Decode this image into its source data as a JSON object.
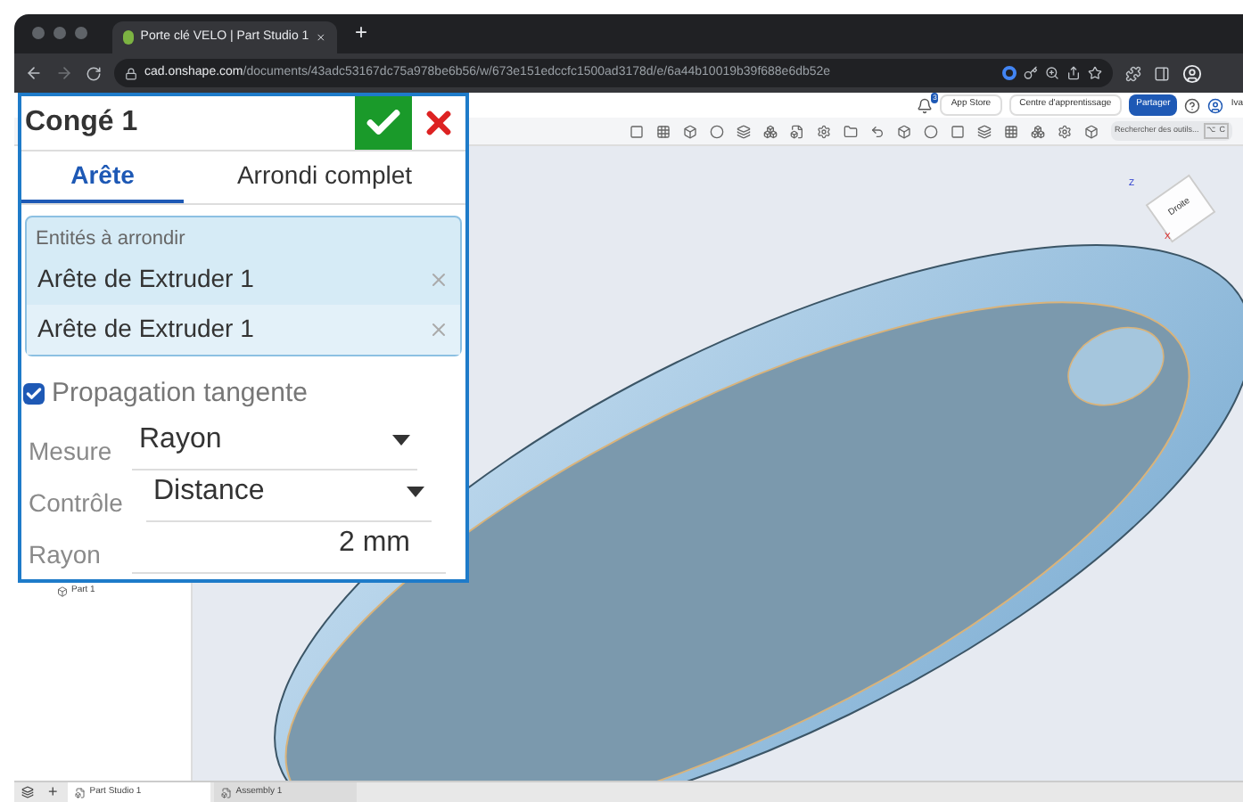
{
  "browser": {
    "tab_title": "Porte clé VELO | Part Studio 1",
    "new_tab": "+",
    "url_host": "cad.onshape.com",
    "url_path": "/documents/43adc53167dc75a978be6b56/w/673e151edccfc1500ad3178d/e/6a44b10019b39f688e6db52e"
  },
  "app_header": {
    "notification_count": "3",
    "buttons": [
      {
        "label": "App Store",
        "kind": "plain"
      },
      {
        "label": "Centre d'apprentissage",
        "kind": "plain"
      },
      {
        "label": "Partager",
        "kind": "primary"
      }
    ],
    "user": "Iva"
  },
  "toolbar": {
    "search_placeholder": "Rechercher des outils...",
    "shortcut": "⌥ C"
  },
  "feature_tree": {
    "items": [
      "Part 1"
    ]
  },
  "view_cube": {
    "face": "Droite",
    "axis_z": "Z",
    "axis_x": "X"
  },
  "dialog": {
    "title": "Congé 1",
    "tabs": [
      {
        "label": "Arête",
        "selected": true
      },
      {
        "label": "Arrondi complet",
        "selected": false
      }
    ],
    "selection": {
      "label": "Entités à arrondir",
      "items": [
        "Arête de Extruder 1",
        "Arête de Extruder 1"
      ]
    },
    "tangent": {
      "label": "Propagation tangente",
      "checked": true
    },
    "fields": [
      {
        "kind": "select",
        "label": "Mesure",
        "value": "Rayon"
      },
      {
        "kind": "select",
        "label": "Contrôle",
        "value": "Distance"
      },
      {
        "kind": "input",
        "label": "Rayon",
        "value": "2 mm"
      }
    ]
  },
  "bottom_tabs": {
    "add": "+",
    "tabs": [
      {
        "label": "Part Studio 1",
        "selected": true
      },
      {
        "label": "Assembly 1",
        "selected": false
      }
    ]
  }
}
